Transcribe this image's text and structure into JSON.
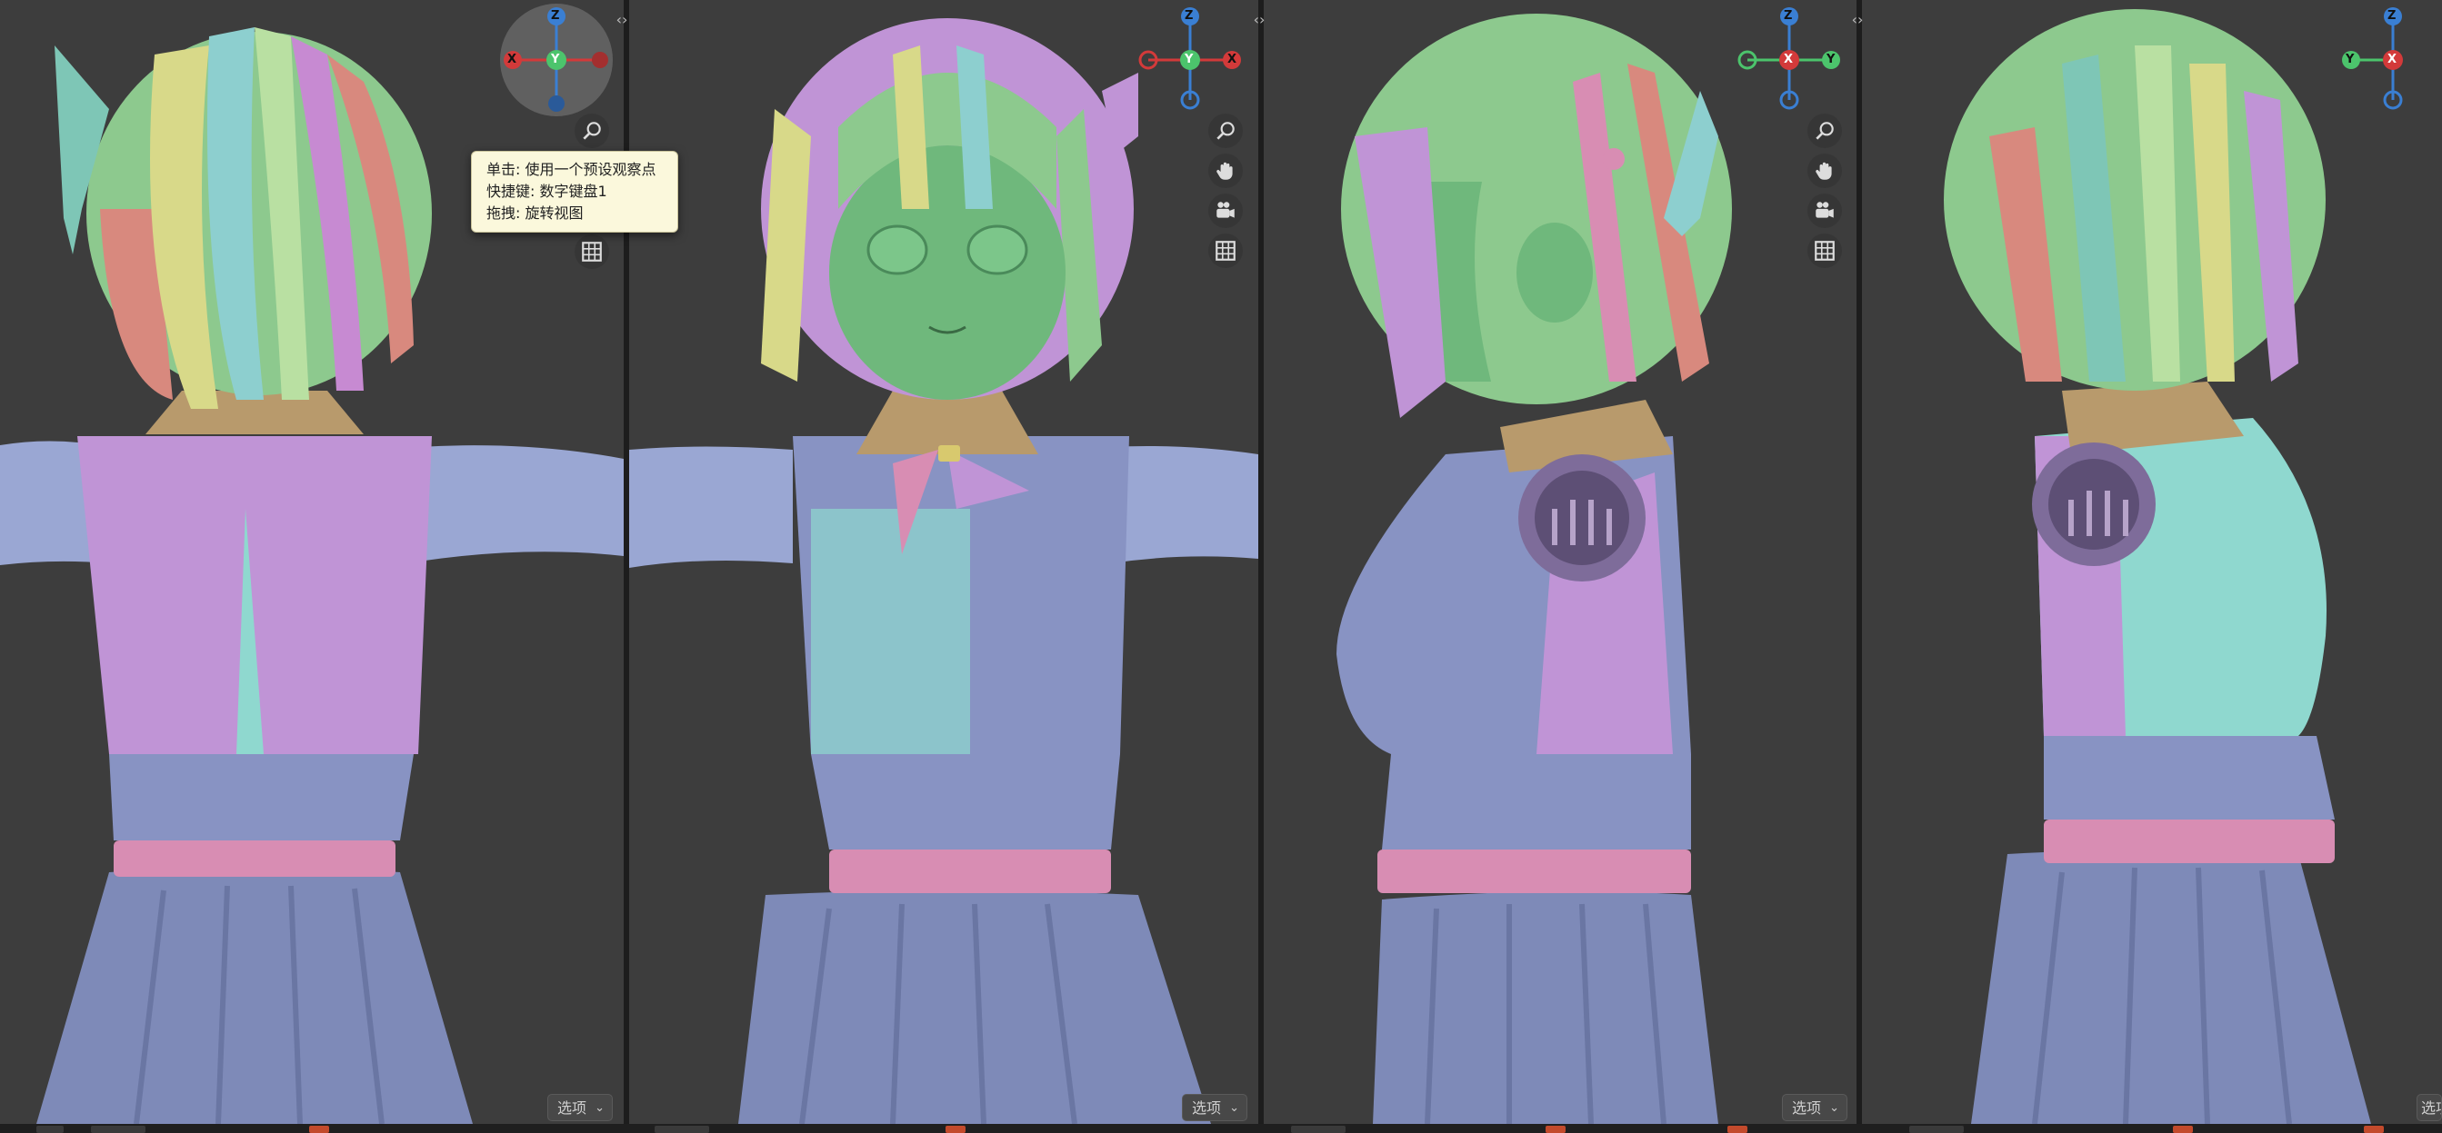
{
  "viewports": [
    {
      "name": "back-view",
      "axes": {
        "up": "Z",
        "left": "X",
        "center": "Y",
        "right": "-X"
      },
      "options_label": "选项"
    },
    {
      "name": "front-view",
      "axes": {
        "up": "Z",
        "left": "-X",
        "center": "Y",
        "right": "X"
      },
      "options_label": "选项"
    },
    {
      "name": "right-view",
      "axes": {
        "up": "Z",
        "left": "-Y",
        "center": "X",
        "right": "Y"
      },
      "options_label": "选项"
    },
    {
      "name": "left-view",
      "axes": {
        "up": "Z",
        "left": "Y",
        "center": "X",
        "right": "-Y"
      },
      "options_label": "选项"
    }
  ],
  "tooltip": {
    "line1": "单击: 使用一个预设观察点",
    "line2": "快捷键: 数字键盘1",
    "line3": "拖拽: 旋转视图"
  },
  "icons": [
    "zoom-icon",
    "hand-icon",
    "camera-icon",
    "grid-icon"
  ],
  "colors": {
    "viewport_bg": "#3d3d3d",
    "axis_x": "#d33a3a",
    "axis_y": "#4cc46c",
    "axis_z": "#3a7fd3",
    "tooltip_bg": "#fbf8dc"
  }
}
